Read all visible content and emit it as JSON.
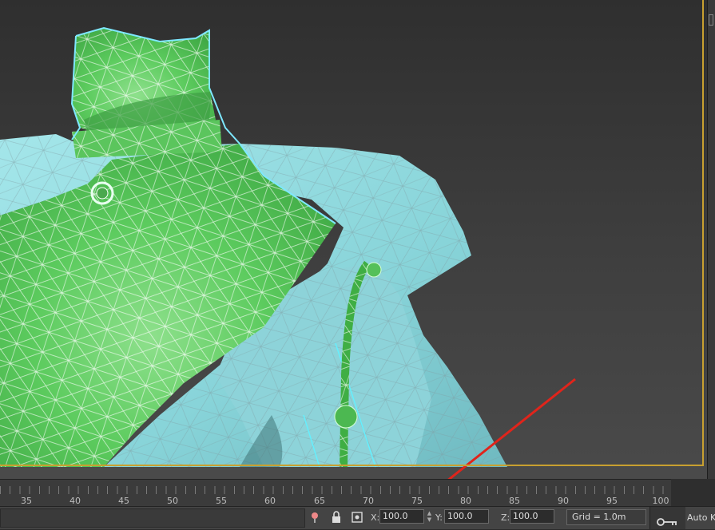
{
  "timeline": {
    "ticks": [
      "35",
      "40",
      "45",
      "50",
      "55",
      "60",
      "65",
      "70",
      "75",
      "80",
      "85",
      "90",
      "95",
      "100"
    ]
  },
  "status": {
    "x_label": "X:",
    "x_value": "100.0",
    "y_label": "Y:",
    "y_value": "100.0",
    "z_label": "Z:",
    "z_value": "100.0",
    "grid": "Grid = 1.0m",
    "auto_key": "Auto Ke"
  },
  "icons": {
    "pin": "pin-icon",
    "lock": "lock-icon",
    "absolute_mode": "transform-mode-icon",
    "key": "key-icon"
  },
  "colors": {
    "selection_border": "#c8a030",
    "mesh_green": "#58c85c",
    "mesh_cyan": "#8fdbe0",
    "annotation_arrow": "#e0241b"
  }
}
